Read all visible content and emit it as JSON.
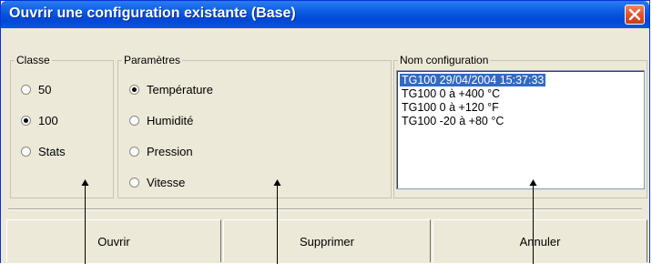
{
  "window": {
    "title": "Ouvrir une configuration existante (Base)"
  },
  "classe": {
    "legend": "Classe",
    "options": [
      {
        "label": "50",
        "checked": false
      },
      {
        "label": "100",
        "checked": true
      },
      {
        "label": "Stats",
        "checked": false
      }
    ]
  },
  "parametres": {
    "legend": "Paramètres",
    "options": [
      {
        "label": "Température",
        "checked": true
      },
      {
        "label": "Humidité",
        "checked": false
      },
      {
        "label": "Pression",
        "checked": false
      },
      {
        "label": "Vitesse",
        "checked": false
      }
    ]
  },
  "configuration": {
    "legend": "Nom configuration",
    "items": [
      {
        "label": "TG100 29/04/2004 15:37:33",
        "selected": true
      },
      {
        "label": "TG100 0 à +400 °C",
        "selected": false
      },
      {
        "label": "TG100 0 à +120 °F",
        "selected": false
      },
      {
        "label": "TG100 -20 à +80 °C",
        "selected": false
      }
    ]
  },
  "buttons": {
    "open": "Ouvrir",
    "delete": "Supprimer",
    "cancel": "Annuler"
  },
  "colors": {
    "titlebar": "#0a5ce3",
    "selection": "#316ac5",
    "dialog_bg": "#ece9d8"
  },
  "icons": {
    "close": "close-icon"
  }
}
